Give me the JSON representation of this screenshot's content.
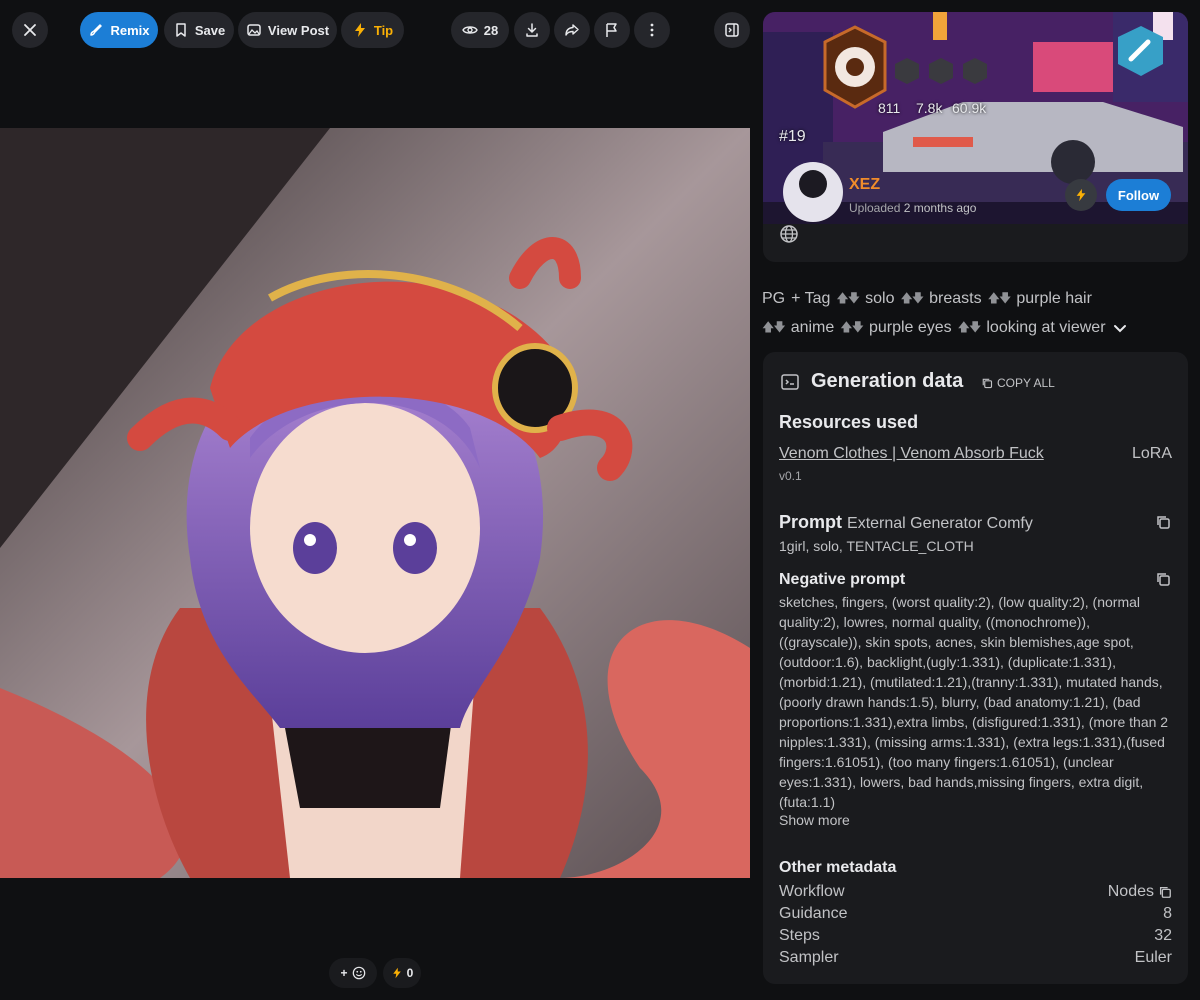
{
  "toolbar": {
    "remix_label": "Remix",
    "save_label": "Save",
    "view_post_label": "View Post",
    "tip_label": "Tip",
    "views_count": "28"
  },
  "reactions": {
    "add_reaction": "+",
    "buzz_count": "0"
  },
  "creator": {
    "stats": [
      "811",
      "7.8k",
      "60.9k"
    ],
    "rank": "#19",
    "username": "XEZ",
    "uploaded_label": "Uploaded",
    "uploaded_time": "2 months ago",
    "follow_label": "Follow"
  },
  "tags": {
    "pg_label": "PG",
    "add_tag_label": "Tag",
    "items": [
      "solo",
      "breasts",
      "purple hair",
      "anime",
      "purple eyes",
      "looking at viewer"
    ]
  },
  "generation": {
    "title": "Generation data",
    "copy_all_label": "COPY ALL",
    "resources_heading": "Resources used",
    "resource": {
      "name": "Venom Clothes | Venom Absorb Fuck",
      "type": "LoRA",
      "version": "v0.1"
    },
    "prompt_heading": "Prompt",
    "prompt_source": "External Generator Comfy",
    "prompt_text": "1girl, solo, TENTACLE_CLOTH",
    "negative_heading": "Negative prompt",
    "negative_text": "sketches, fingers, (worst quality:2), (low quality:2), (normal quality:2), lowres, normal quality, ((monochrome)), ((grayscale)), skin spots, acnes, skin blemishes,age spot, (outdoor:1.6), backlight,(ugly:1.331), (duplicate:1.331), (morbid:1.21), (mutilated:1.21),(tranny:1.331), mutated hands, (poorly drawn hands:1.5), blurry, (bad anatomy:1.21), (bad proportions:1.331),extra limbs, (disfigured:1.331), (more than 2 nipples:1.331), (missing arms:1.331), (extra legs:1.331),(fused fingers:1.61051), (too many fingers:1.61051), (unclear eyes:1.331), lowers, bad hands,missing fingers, extra digit, (futa:1.1)",
    "show_more_label": "Show more",
    "other_heading": "Other metadata",
    "metadata": [
      {
        "key": "Workflow",
        "value": "Nodes"
      },
      {
        "key": "Guidance",
        "value": "8"
      },
      {
        "key": "Steps",
        "value": "32"
      },
      {
        "key": "Sampler",
        "value": "Euler"
      }
    ]
  },
  "colors": {
    "accent": "#1c7ed6",
    "buzz": "#fab005",
    "username": "#f08c2b",
    "panel": "#1a1b1e",
    "page": "#0f1012"
  }
}
